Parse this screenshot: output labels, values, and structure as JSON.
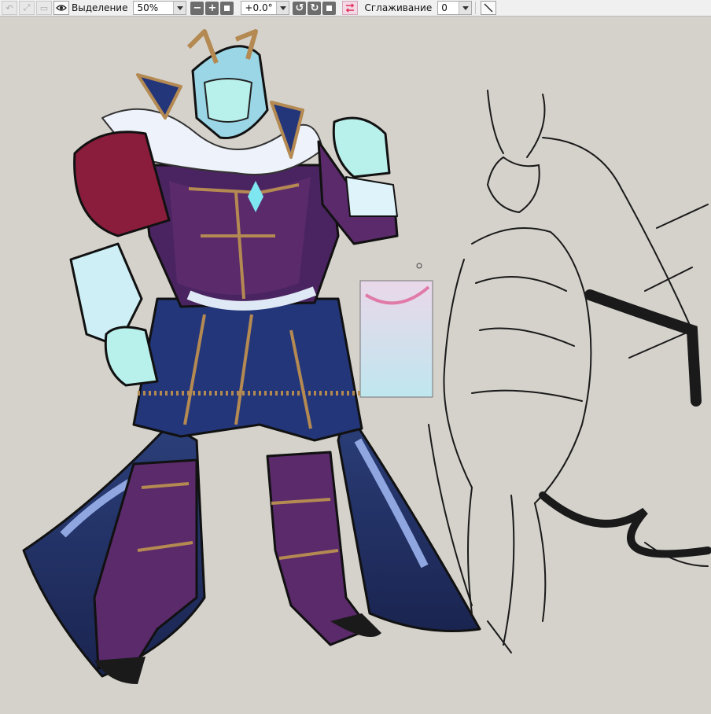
{
  "toolbar": {
    "selection_label": "Выделение",
    "zoom_value": "50%",
    "rotation_value": "+0.0°",
    "smoothing_label": "Сглаживание",
    "smoothing_value": "0"
  },
  "colors": {
    "canvas_bg": "#d5d2cc",
    "armor_purple": "#5a2a6a",
    "armor_blue": "#23367a",
    "trim_gold": "#b48a52",
    "ice_cyan": "#b8f0ec",
    "swap_icon_accent": "#e03060"
  },
  "canvas": {
    "layers": [
      "colored-character-drawing",
      "line-sketch-drawing",
      "gradient-swatch"
    ]
  }
}
